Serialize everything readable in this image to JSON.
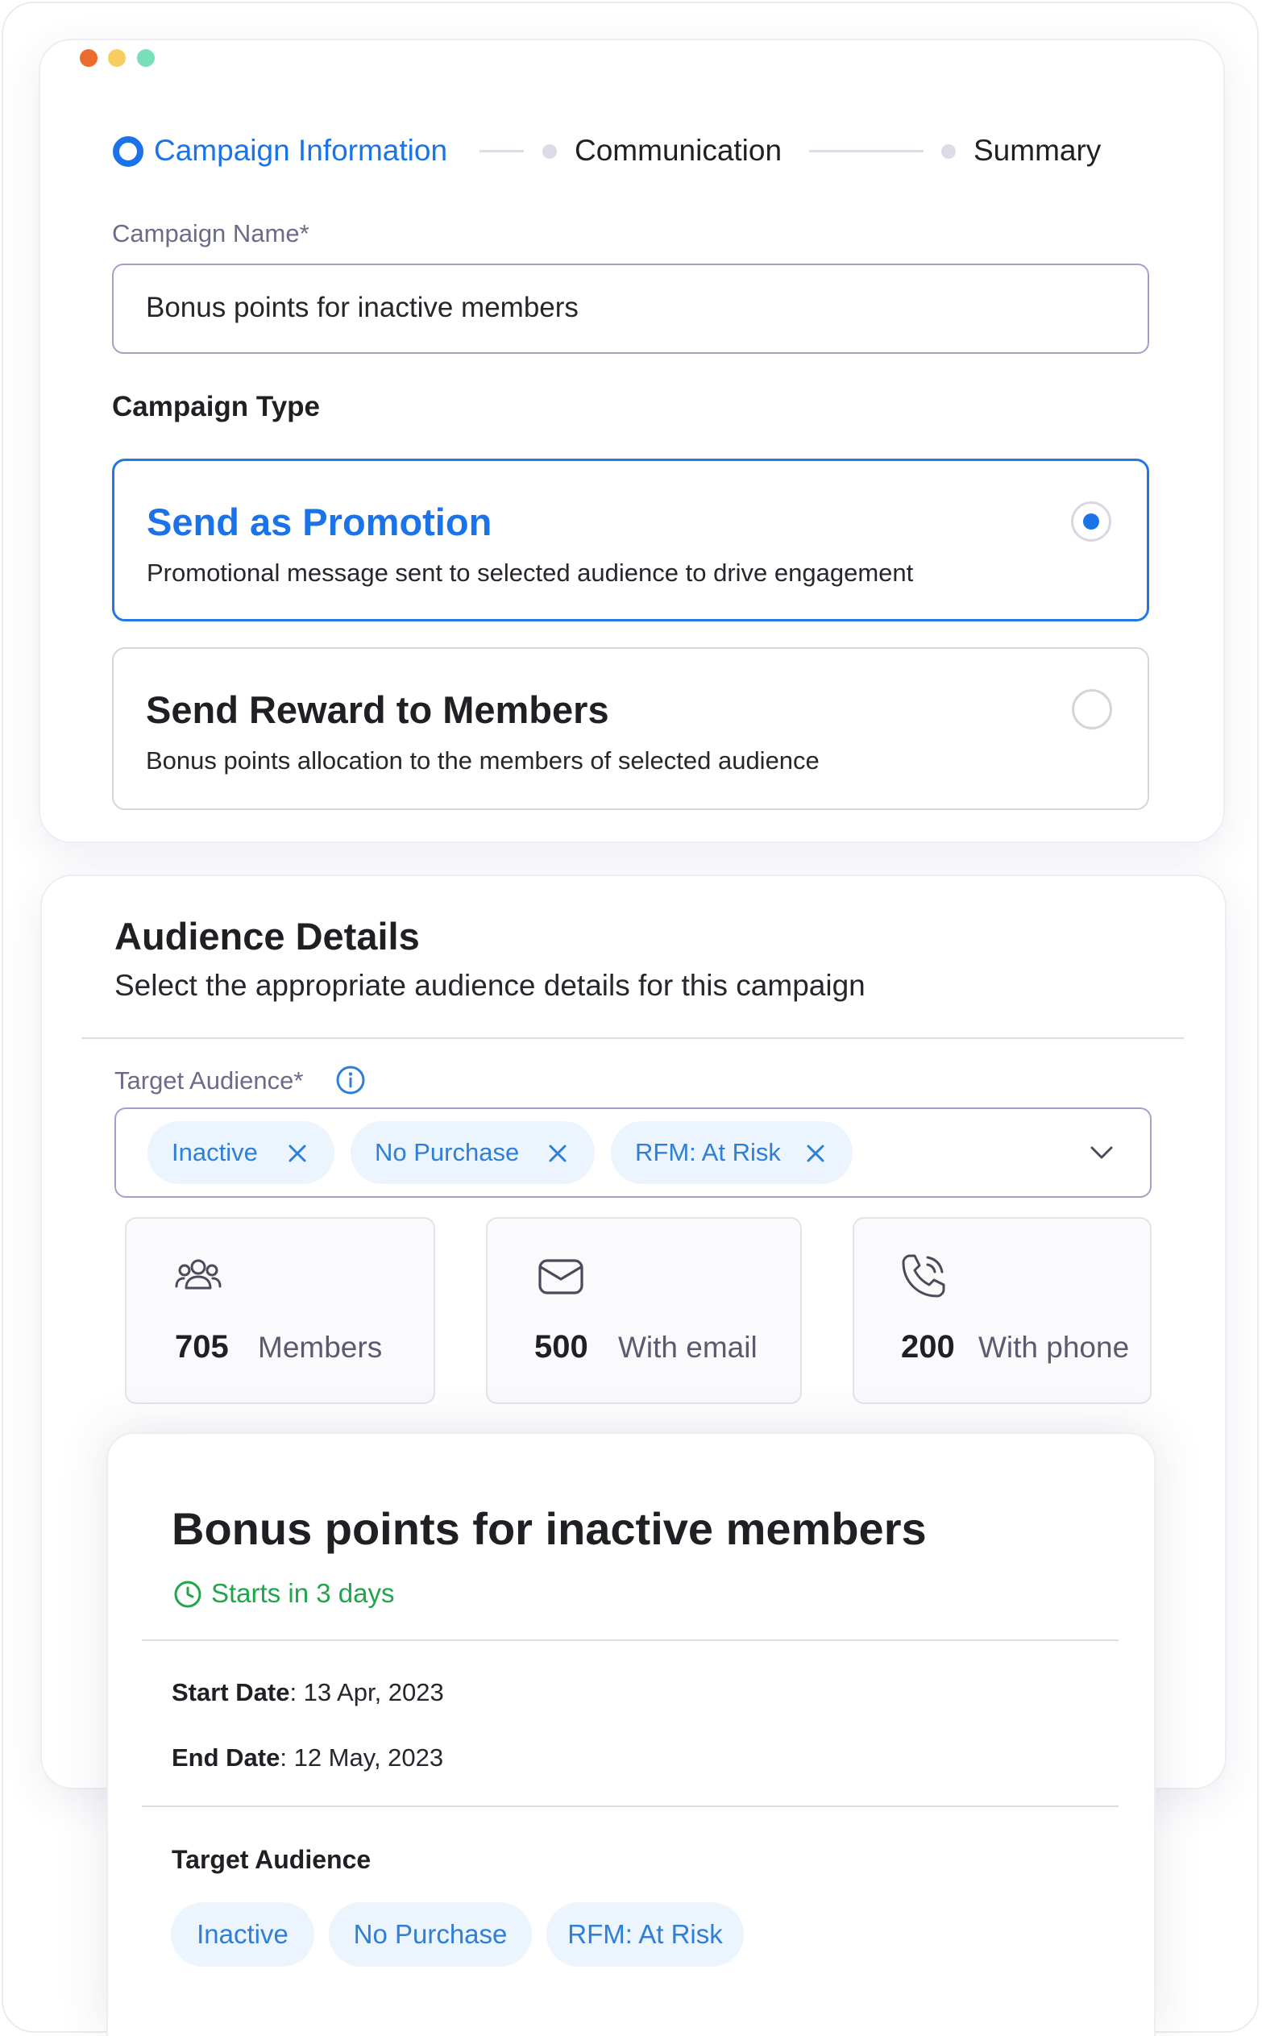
{
  "window": {
    "dot_colors": [
      "#ec6a2c",
      "#f6cd5e",
      "#79dfb8"
    ]
  },
  "stepper": {
    "steps": [
      {
        "label": "Campaign Information",
        "state": "active"
      },
      {
        "label": "Communication",
        "state": "pending"
      },
      {
        "label": "Summary",
        "state": "pending"
      }
    ]
  },
  "campaign": {
    "name_label": "Campaign Name*",
    "name_value": "Bonus points for inactive members",
    "type_heading": "Campaign Type",
    "options": [
      {
        "title": "Send as Promotion",
        "description": "Promotional message sent to selected audience to drive engagement",
        "selected": true
      },
      {
        "title": "Send Reward to Members",
        "description": "Bonus points allocation to the members of selected audience",
        "selected": false
      }
    ]
  },
  "audience": {
    "heading": "Audience Details",
    "subheading": "Select the appropriate audience details for this campaign",
    "target_label": "Target Audience*",
    "info_icon": "info-icon",
    "selected_chips": [
      "Inactive",
      "No Purchase",
      "RFM: At Risk"
    ],
    "dropdown_icon": "chevron-down-icon",
    "stats": [
      {
        "icon": "members-icon",
        "value": "705",
        "label": "Members"
      },
      {
        "icon": "email-icon",
        "value": "500",
        "label": "With email"
      },
      {
        "icon": "phone-icon",
        "value": "200",
        "label": "With phone"
      }
    ]
  },
  "summary": {
    "title": "Bonus points for inactive members",
    "status": "Starts in 3 days",
    "status_color": "#1fa64a",
    "start_date_label": "Start Date",
    "start_date_value": ": 13 Apr, 2023",
    "end_date_label": "End Date",
    "end_date_value": ": 12 May, 2023",
    "target_heading": "Target Audience",
    "target_tags": [
      "Inactive",
      "No Purchase",
      "RFM: At Risk"
    ]
  },
  "colors": {
    "accent": "#1a73e8",
    "chip_bg": "#ecf4fd",
    "chip_text": "#2f7fd6"
  }
}
